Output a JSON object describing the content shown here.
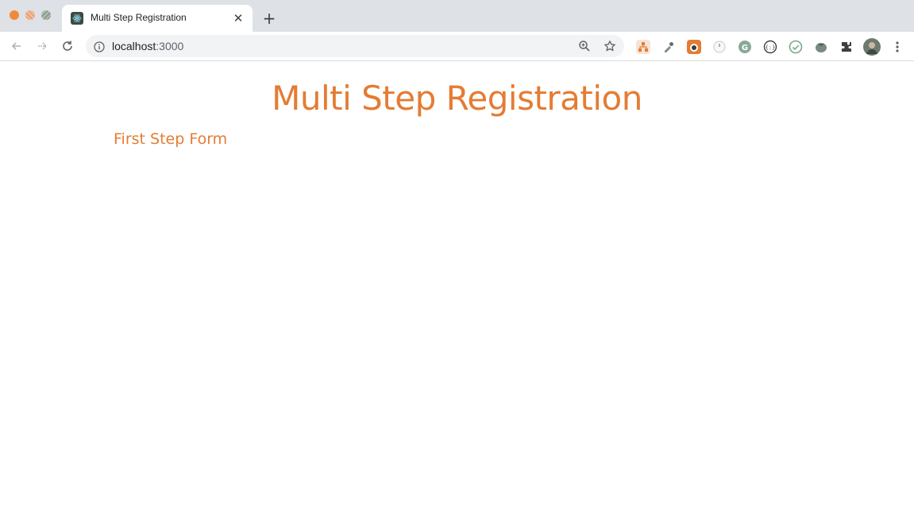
{
  "browser": {
    "tab": {
      "title": "Multi Step Registration"
    },
    "url": {
      "host": "localhost",
      "port": ":3000"
    },
    "icons": [
      "back-icon",
      "forward-icon",
      "reload-icon",
      "info-icon",
      "zoom-icon",
      "star-icon",
      "extensions-icon",
      "profile-avatar",
      "menu-icon"
    ]
  },
  "page": {
    "title": "Multi Step Registration",
    "step_title": "First Step Form"
  },
  "colors": {
    "accent": "#e47c33",
    "tabstrip": "#dee1e6",
    "omnibox": "#f1f3f4"
  }
}
